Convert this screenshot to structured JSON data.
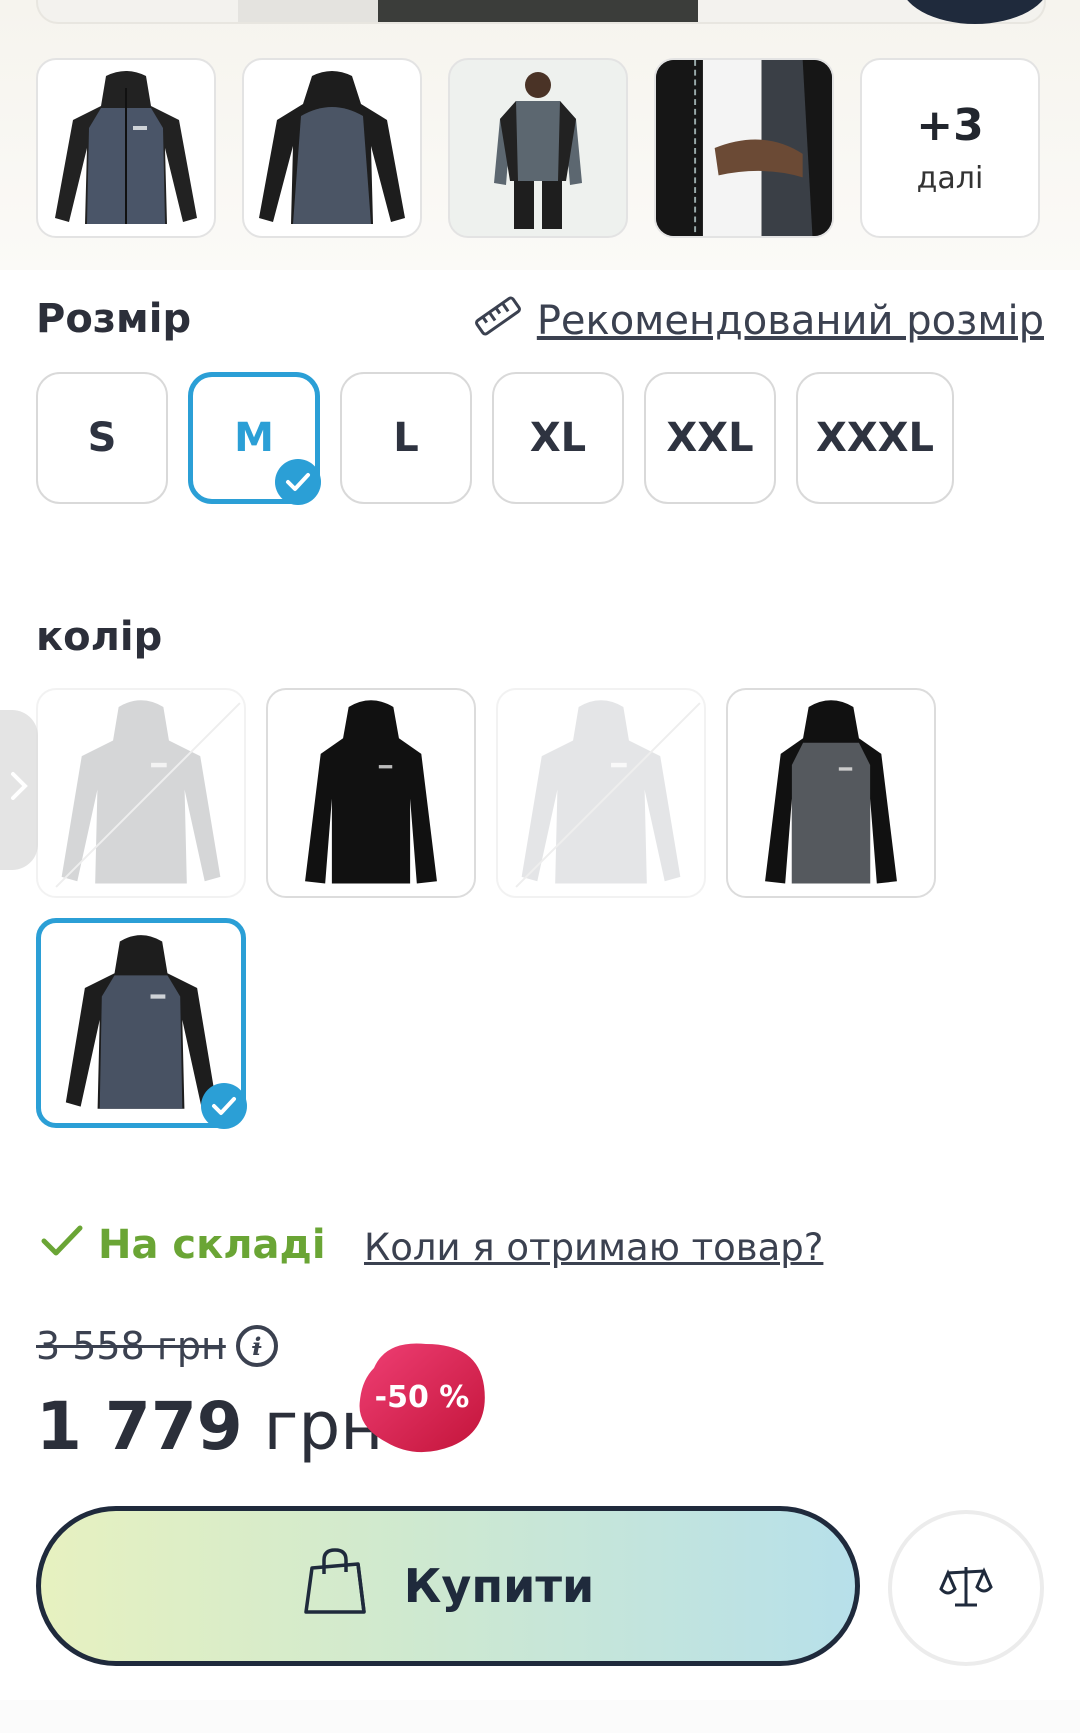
{
  "thumbnails": {
    "more_count": "+3",
    "more_label": "далі"
  },
  "size_section": {
    "title": "Розмір",
    "recommended_link": "Рекомендований розмір",
    "options": [
      "S",
      "M",
      "L",
      "XL",
      "XXL",
      "XXXL"
    ],
    "selected": "M"
  },
  "color_section": {
    "title": "колір",
    "swatches": [
      {
        "variant": "grey",
        "available": false
      },
      {
        "variant": "black",
        "available": true
      },
      {
        "variant": "light-grey",
        "available": false
      },
      {
        "variant": "seal-grey-black",
        "available": true
      },
      {
        "variant": "india-grey-black",
        "available": true,
        "selected": true
      }
    ]
  },
  "stock": {
    "status": "На складі",
    "delivery_link": "Коли я отримаю товар?"
  },
  "price": {
    "old": "3 558 грн",
    "new_amount": "1 779",
    "new_currency": "грн",
    "discount": "-50 %"
  },
  "buy": {
    "label": "Купити"
  },
  "colors": {
    "accent": "#2b9fd6",
    "stock_green": "#6aa535",
    "dark": "#1f2a3c",
    "discount_from": "#e8336b",
    "discount_to": "#c4173c"
  },
  "icons": {
    "ruler": "ruler-icon",
    "check": "check-icon",
    "info": "info-icon",
    "bag": "shopping-bag-icon",
    "scale": "scale-icon",
    "chevron": "chevron-right-icon"
  }
}
